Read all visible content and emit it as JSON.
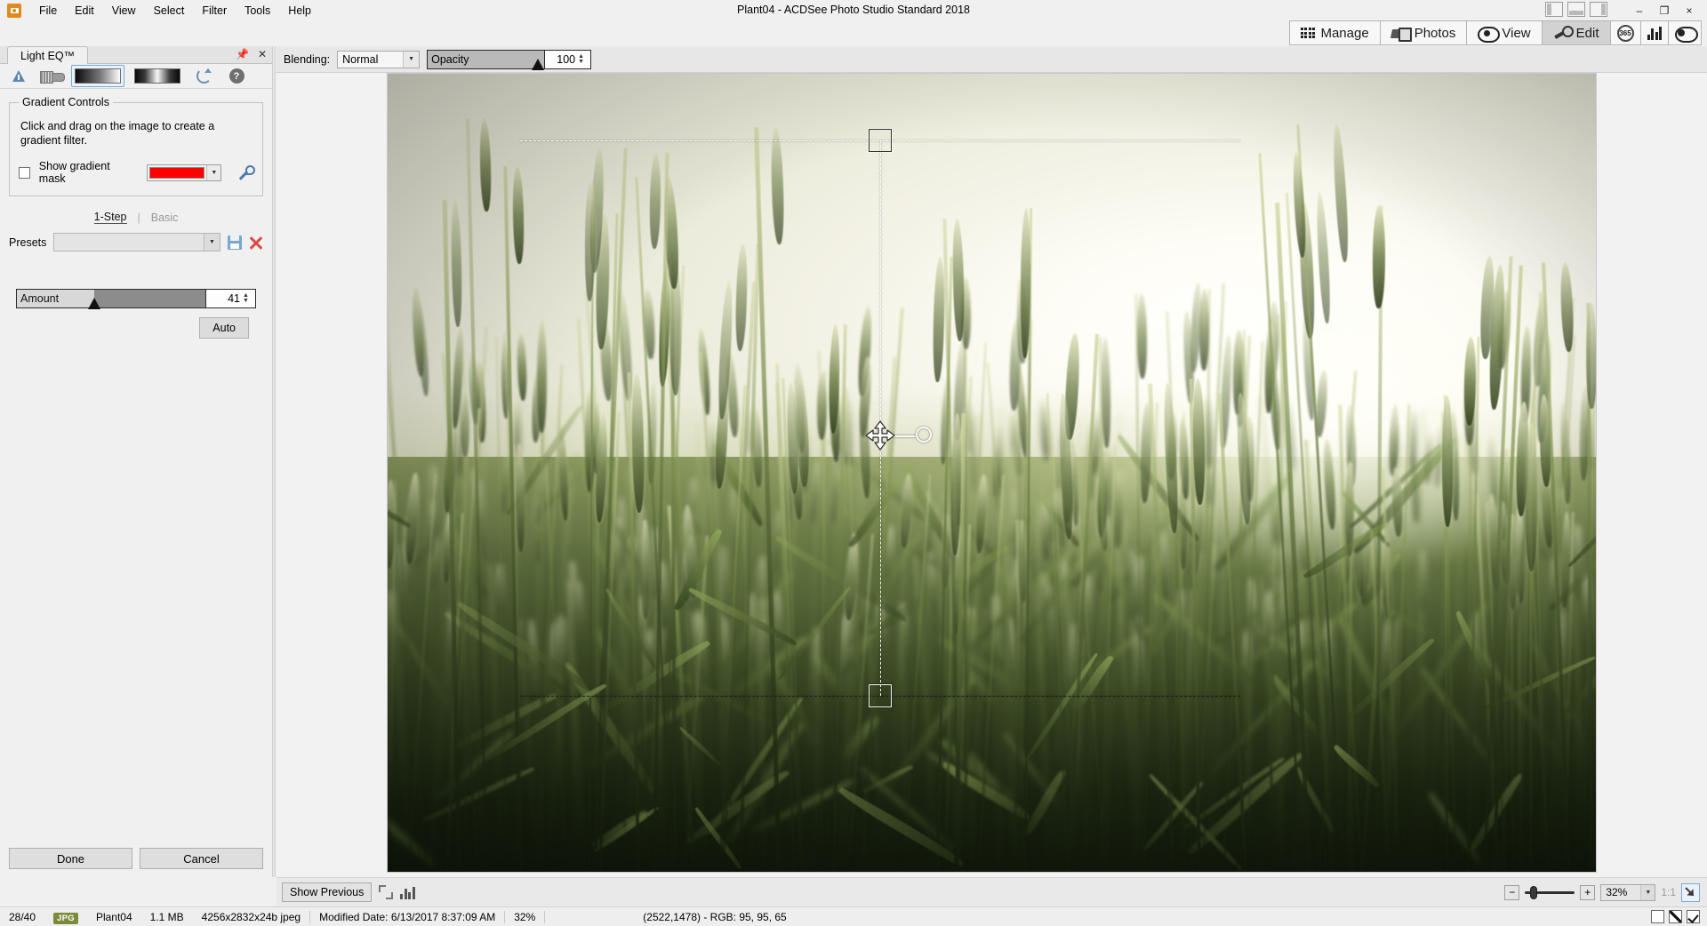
{
  "window": {
    "title": "Plant04 - ACDSee Photo Studio Standard 2018",
    "logo_icon": "acdsee-logo-icon",
    "minimize": "–",
    "restore": "❐",
    "close": "×"
  },
  "menubar": {
    "items": [
      "File",
      "Edit",
      "View",
      "Select",
      "Filter",
      "Tools",
      "Help"
    ]
  },
  "layout_buttons": [
    {
      "name": "layout-left-panel",
      "icon": "panel-left-icon"
    },
    {
      "name": "layout-bottom-panel",
      "icon": "panel-bottom-icon"
    },
    {
      "name": "layout-right-panel",
      "icon": "panel-right-icon"
    }
  ],
  "mode_tabs": [
    {
      "label": "Manage",
      "icon": "grid-icon",
      "active": false
    },
    {
      "label": "Photos",
      "icon": "photos-icon",
      "active": false
    },
    {
      "label": "View",
      "icon": "eye-icon",
      "active": false
    },
    {
      "label": "Edit",
      "icon": "edit-brush-icon",
      "active": true
    },
    {
      "label": "365",
      "icon": "acdsee-365-icon",
      "active": false
    },
    {
      "label": "",
      "icon": "histogram-icon",
      "active": false
    },
    {
      "label": "",
      "icon": "preview-eye-icon",
      "active": false
    }
  ],
  "panel": {
    "tab_label": "Light EQ™",
    "pin_icon": "pin-icon",
    "close_icon": "close-icon",
    "toolbar": [
      {
        "name": "warning-icon",
        "title": "Warning"
      },
      {
        "name": "brush-icon",
        "title": "Brush"
      },
      {
        "name": "linear-gradient-icon",
        "title": "Linear Gradient",
        "selected": true
      },
      {
        "name": "radial-gradient-icon",
        "title": "Radial Gradient",
        "selected": false
      },
      {
        "name": "reset-icon",
        "title": "Reset"
      },
      {
        "name": "help-icon",
        "title": "Help"
      }
    ],
    "group_title": "Gradient Controls",
    "hint": "Click and drag on the image to create a gradient filter.",
    "show_mask_label": "Show gradient mask",
    "show_mask_checked": false,
    "mask_color": "#ff0000",
    "eyedropper_icon": "eyedropper-icon",
    "steps": [
      {
        "label": "1-Step",
        "active": true
      },
      {
        "label": "Basic",
        "active": false
      }
    ],
    "presets_label": "Presets",
    "presets_value": "",
    "save_preset_icon": "save-icon",
    "delete_preset_icon": "delete-x-icon",
    "amount": {
      "label": "Amount",
      "value": "41",
      "min": 0,
      "max": 100,
      "fill_percent": 41
    },
    "auto_label": "Auto",
    "done_label": "Done",
    "cancel_label": "Cancel"
  },
  "edit_toolbar": {
    "blending_label": "Blending:",
    "blending_value": "Normal",
    "opacity_label": "Opacity",
    "opacity_value": "100",
    "opacity_percent": 100
  },
  "canvas": {
    "image_name": "Plant04",
    "description": "Backlit wheat / rye field at sunrise with blurred stalks and bright sky",
    "gradient_overlay": {
      "top_line_y_pct": 8.4,
      "bottom_line_y_pct": 78.0,
      "center_x_pct": 40.8,
      "move_cursor_icon": "move-cursor-icon",
      "rotate_handle_icon": "rotate-handle-icon"
    }
  },
  "bottom_toolbar": {
    "show_previous_label": "Show Previous",
    "fullscreen_icon": "expand-icon",
    "histogram_icon": "histogram-icon",
    "zoom_out_label": "−",
    "zoom_in_label": "+",
    "zoom_value": "32%",
    "one_to_one_label": "1:1",
    "fit_icon": "fit-to-window-icon"
  },
  "statusbar": {
    "counter": "28/40",
    "format_badge": "JPG",
    "filename": "Plant04",
    "filesize": "1.1 MB",
    "dimensions": "4256x2832x24b jpeg",
    "modified": "Modified Date: 6/13/2017 8:37:09 AM",
    "zoom": "32%",
    "pixel_info": "(2522,1478) - RGB: 95, 95, 65",
    "right_icons": [
      {
        "name": "background-color-icon"
      },
      {
        "name": "transparency-icon"
      },
      {
        "name": "checkmark-icon"
      }
    ]
  },
  "colors": {
    "window_bg": "#f0f0f0",
    "panel_bg": "#f0f0f0",
    "accent_blue": "#7aa9d6",
    "mask_red": "#ff0000",
    "jpg_badge": "#7b8b3a"
  }
}
